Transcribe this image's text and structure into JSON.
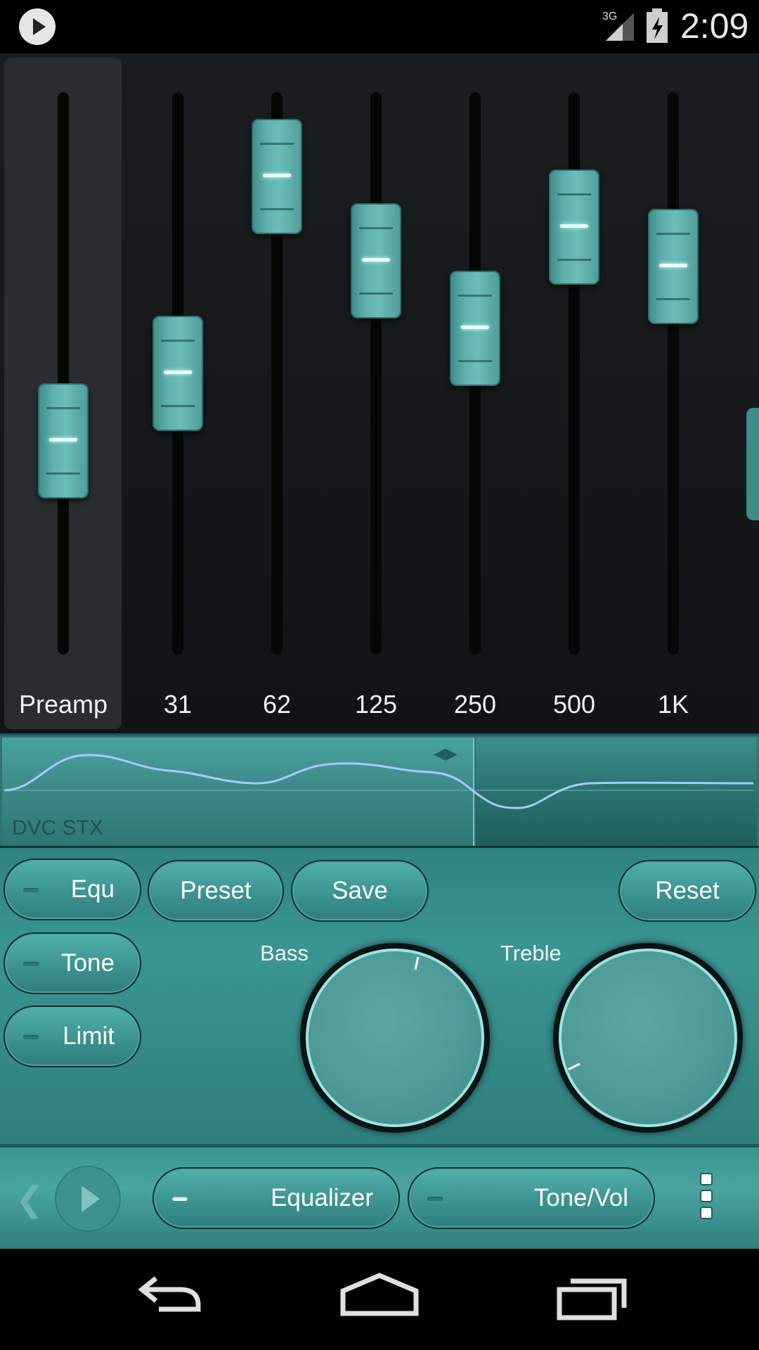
{
  "status_bar": {
    "time": "2:09",
    "network": "3G"
  },
  "equalizer": {
    "bands": [
      {
        "label": "Preamp",
        "level": 0.38
      },
      {
        "label": "31",
        "level": 0.5
      },
      {
        "label": "62",
        "level": 0.85
      },
      {
        "label": "125",
        "level": 0.7
      },
      {
        "label": "250",
        "level": 0.58
      },
      {
        "label": "500",
        "level": 0.76
      },
      {
        "label": "1K",
        "level": 0.69
      }
    ]
  },
  "curve": {
    "tag": "DVC STX",
    "arrows": "◀▶"
  },
  "controls": {
    "equ_label": "Equ",
    "preset_label": "Preset",
    "save_label": "Save",
    "reset_label": "Reset",
    "tone_label": "Tone",
    "limit_label": "Limit",
    "bass_label": "Bass",
    "treble_label": "Treble"
  },
  "bottom_bar": {
    "equalizer_label": "Equalizer",
    "tone_vol_label": "Tone/Vol",
    "back_chevron": "❮"
  },
  "colors": {
    "accent": "#3d9592",
    "panel_dark": "#1b1e20",
    "dial_marker": "#ffffff"
  },
  "icons": [
    "play-icon",
    "signal-icon",
    "battery-icon",
    "back-icon",
    "home-icon",
    "recents-icon",
    "menu-icon"
  ]
}
